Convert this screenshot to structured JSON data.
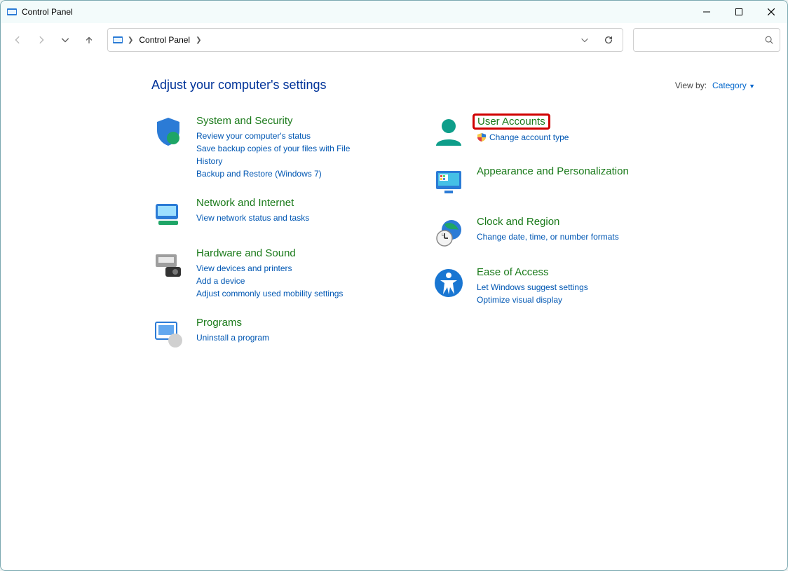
{
  "window": {
    "title": "Control Panel"
  },
  "breadcrumb": {
    "root": "Control Panel"
  },
  "heading": "Adjust your computer's settings",
  "view_by": {
    "label": "View by:",
    "value": "Category"
  },
  "left": [
    {
      "title": "System and Security",
      "subs": [
        "Review your computer's status",
        "Save backup copies of your files with File History",
        "Backup and Restore (Windows 7)"
      ]
    },
    {
      "title": "Network and Internet",
      "subs": [
        "View network status and tasks"
      ]
    },
    {
      "title": "Hardware and Sound",
      "subs": [
        "View devices and printers",
        "Add a device",
        "Adjust commonly used mobility settings"
      ]
    },
    {
      "title": "Programs",
      "subs": [
        "Uninstall a program"
      ]
    }
  ],
  "right": [
    {
      "title": "User Accounts",
      "subs": [
        "Change account type"
      ],
      "shield": true,
      "highlighted": true
    },
    {
      "title": "Appearance and Personalization",
      "subs": []
    },
    {
      "title": "Clock and Region",
      "subs": [
        "Change date, time, or number formats"
      ]
    },
    {
      "title": "Ease of Access",
      "subs": [
        "Let Windows suggest settings",
        "Optimize visual display"
      ]
    }
  ]
}
